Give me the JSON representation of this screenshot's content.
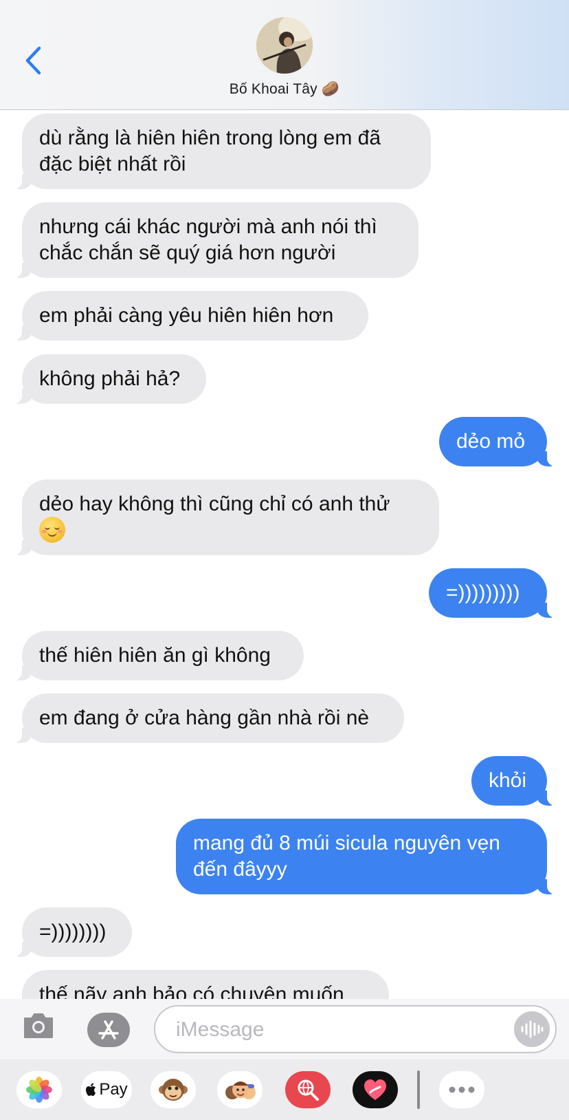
{
  "header": {
    "back_icon": "chevron-left-icon",
    "contact_name": "Bố Khoai Tây 🥔",
    "avatar_icon": "contact-avatar-photo"
  },
  "messages": [
    {
      "direction": "received",
      "text": "dù rằng là hiên hiên trong lòng em đã đặc biệt nhất rồi"
    },
    {
      "direction": "received",
      "text": "nhưng cái khác người mà anh nói thì chắc chắn sẽ quý giá hơn người"
    },
    {
      "direction": "received",
      "text": "em phải càng yêu hiên hiên hơn"
    },
    {
      "direction": "received",
      "text": "không phải hả?"
    },
    {
      "direction": "sent",
      "text": "dẻo mỏ"
    },
    {
      "direction": "received",
      "text": "dẻo hay không thì cũng chỉ có anh thử",
      "emoji": "smiling-blush-face-emoji"
    },
    {
      "direction": "sent",
      "text": "=)))))))))"
    },
    {
      "direction": "received",
      "text": "thế hiên hiên ăn gì không"
    },
    {
      "direction": "received",
      "text": "em đang ở cửa hàng gần nhà rồi nè"
    },
    {
      "direction": "sent",
      "text": "khỏi"
    },
    {
      "direction": "sent",
      "text": "mang đủ 8 múi sicula nguyên vẹn đến đâyyy"
    },
    {
      "direction": "received",
      "text": "=))))))))"
    },
    {
      "direction": "received",
      "text": "thế nãy anh bảo có chuyện muốn"
    }
  ],
  "input_bar": {
    "camera_icon": "camera-icon",
    "apps_icon": "app-store-icon",
    "placeholder": "iMessage",
    "voice_icon": "waveform-icon"
  },
  "app_drawer": {
    "items": [
      {
        "name": "photos-app-icon"
      },
      {
        "name": "apple-pay-app",
        "label": "Pay"
      },
      {
        "name": "animoji-monkey-icon"
      },
      {
        "name": "memoji-stickers-icon"
      },
      {
        "name": "web-images-search-icon"
      },
      {
        "name": "digital-touch-heart-icon"
      },
      {
        "name": "more-apps-icon"
      }
    ]
  },
  "colors": {
    "sent_bubble": "#3c83f1",
    "received_bubble": "#e9e9eb",
    "accent": "#2f7cf6"
  }
}
